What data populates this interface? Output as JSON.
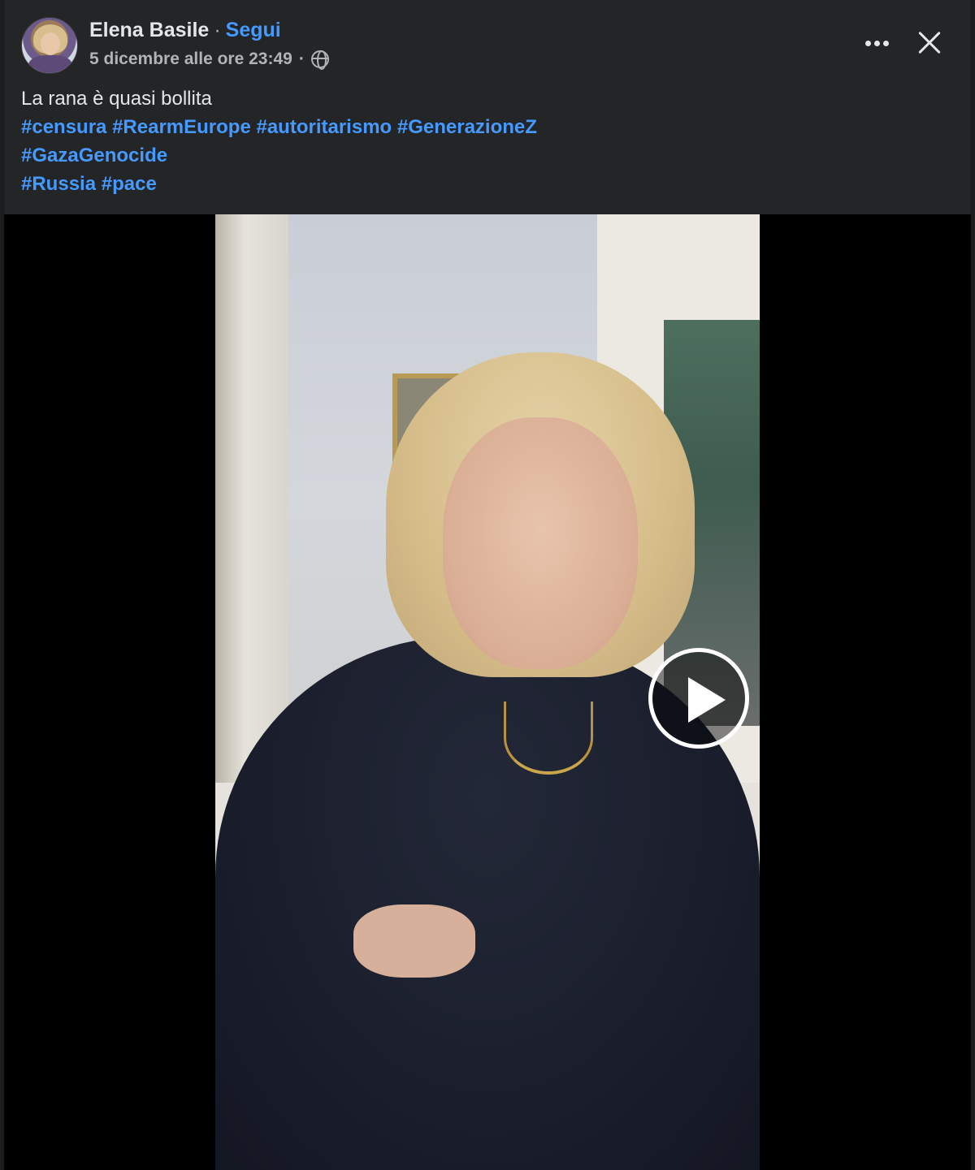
{
  "post": {
    "author_name": "Elena Basile",
    "separator": "·",
    "follow_label": "Segui",
    "timestamp": "5 dicembre alle ore 23:49",
    "meta_separator": "·",
    "visibility_icon": "globe-icon",
    "caption_text": "La rana è quasi bollita",
    "hashtags_line1": [
      "#censura",
      "#RearmEurope",
      "#autoritarismo",
      "#GenerazioneZ"
    ],
    "hashtags_line2": [
      "#GazaGenocide"
    ],
    "hashtags_line3": [
      "#Russia",
      "#pace"
    ]
  },
  "actions": {
    "more_icon": "more-horizontal-icon",
    "close_icon": "close-icon"
  },
  "video": {
    "play_icon": "play-icon"
  },
  "colors": {
    "background": "#242526",
    "text": "#e4e6eb",
    "secondary_text": "#b0b3b8",
    "link": "#4599ff"
  }
}
